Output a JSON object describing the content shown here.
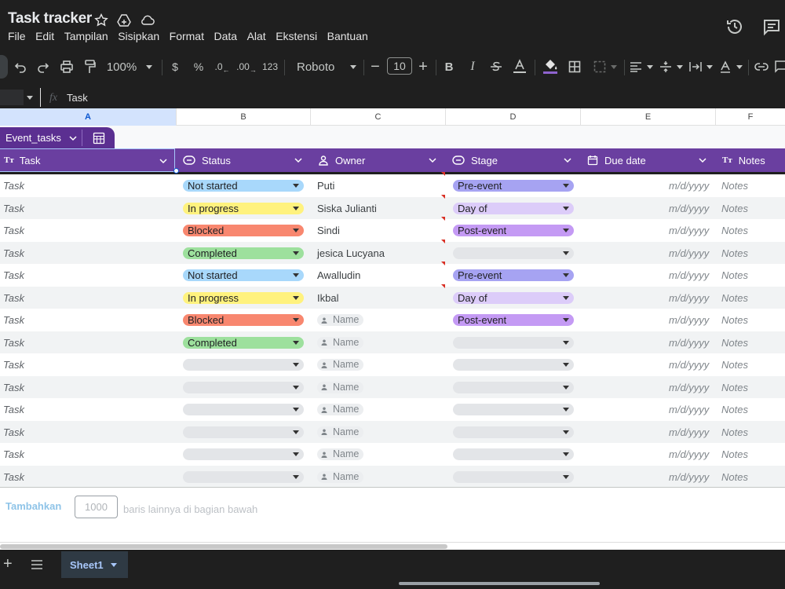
{
  "app": {
    "title": "Task tracker"
  },
  "menu": [
    "File",
    "Edit",
    "Tampilan",
    "Sisipkan",
    "Format",
    "Data",
    "Alat",
    "Ekstensi",
    "Bantuan"
  ],
  "toolbar": {
    "zoom": "100%",
    "currency": "$",
    "percent": "%",
    "dec_minus": ".0",
    "dec_plus": ".00",
    "num_format": "123",
    "font": "Roboto",
    "font_size": "10",
    "bold": "B",
    "italic": "I"
  },
  "formula": {
    "fx": "fx",
    "value": "Task"
  },
  "columns": [
    "A",
    "B",
    "C",
    "D",
    "E",
    "F"
  ],
  "table": {
    "name": "Event_tasks",
    "headers": {
      "task": "Task",
      "status": "Status",
      "owner": "Owner",
      "stage": "Stage",
      "due": "Due date",
      "notes": "Notes"
    },
    "rows": [
      {
        "task": "Task",
        "status": "Not started",
        "owner": "Puti",
        "stage": "Pre-event",
        "due": "m/d/yyyy",
        "notes": "Notes"
      },
      {
        "task": "Task",
        "status": "In progress",
        "owner": "Siska Julianti",
        "stage": "Day of",
        "due": "m/d/yyyy",
        "notes": "Notes"
      },
      {
        "task": "Task",
        "status": "Blocked",
        "owner": "Sindi",
        "stage": "Post-event",
        "due": "m/d/yyyy",
        "notes": "Notes"
      },
      {
        "task": "Task",
        "status": "Completed",
        "owner": "jesica Lucyana",
        "stage": "",
        "due": "m/d/yyyy",
        "notes": "Notes"
      },
      {
        "task": "Task",
        "status": "Not started",
        "owner": "Awalludin",
        "stage": "Pre-event",
        "due": "m/d/yyyy",
        "notes": "Notes"
      },
      {
        "task": "Task",
        "status": "In progress",
        "owner": "Ikbal",
        "stage": "Day of",
        "due": "m/d/yyyy",
        "notes": "Notes"
      },
      {
        "task": "Task",
        "status": "Blocked",
        "owner": "Name",
        "stage": "Post-event",
        "due": "m/d/yyyy",
        "notes": "Notes"
      },
      {
        "task": "Task",
        "status": "Completed",
        "owner": "Name",
        "stage": "",
        "due": "m/d/yyyy",
        "notes": "Notes"
      },
      {
        "task": "Task",
        "status": "",
        "owner": "Name",
        "stage": "",
        "due": "m/d/yyyy",
        "notes": "Notes"
      },
      {
        "task": "Task",
        "status": "",
        "owner": "Name",
        "stage": "",
        "due": "m/d/yyyy",
        "notes": "Notes"
      },
      {
        "task": "Task",
        "status": "",
        "owner": "Name",
        "stage": "",
        "due": "m/d/yyyy",
        "notes": "Notes"
      },
      {
        "task": "Task",
        "status": "",
        "owner": "Name",
        "stage": "",
        "due": "m/d/yyyy",
        "notes": "Notes"
      },
      {
        "task": "Task",
        "status": "",
        "owner": "Name",
        "stage": "",
        "due": "m/d/yyyy",
        "notes": "Notes"
      },
      {
        "task": "Task",
        "status": "",
        "owner": "Name",
        "stage": "",
        "due": "m/d/yyyy",
        "notes": "Notes"
      }
    ]
  },
  "status_colors": {
    "Not started": "#a8d8fb",
    "In progress": "#fff27e",
    "Blocked": "#f8876f",
    "Completed": "#9de09d",
    "": "#e3e5e8"
  },
  "stage_colors": {
    "Pre-event": "#a6a3f2",
    "Day of": "#dcccf9",
    "Post-event": "#c49af4",
    "": "#e3e5e8"
  },
  "add_rows": {
    "button": "Tambahkan",
    "count": "1000",
    "suffix": "baris lainnya di bagian bawah"
  },
  "sheet": {
    "name": "Sheet1"
  }
}
